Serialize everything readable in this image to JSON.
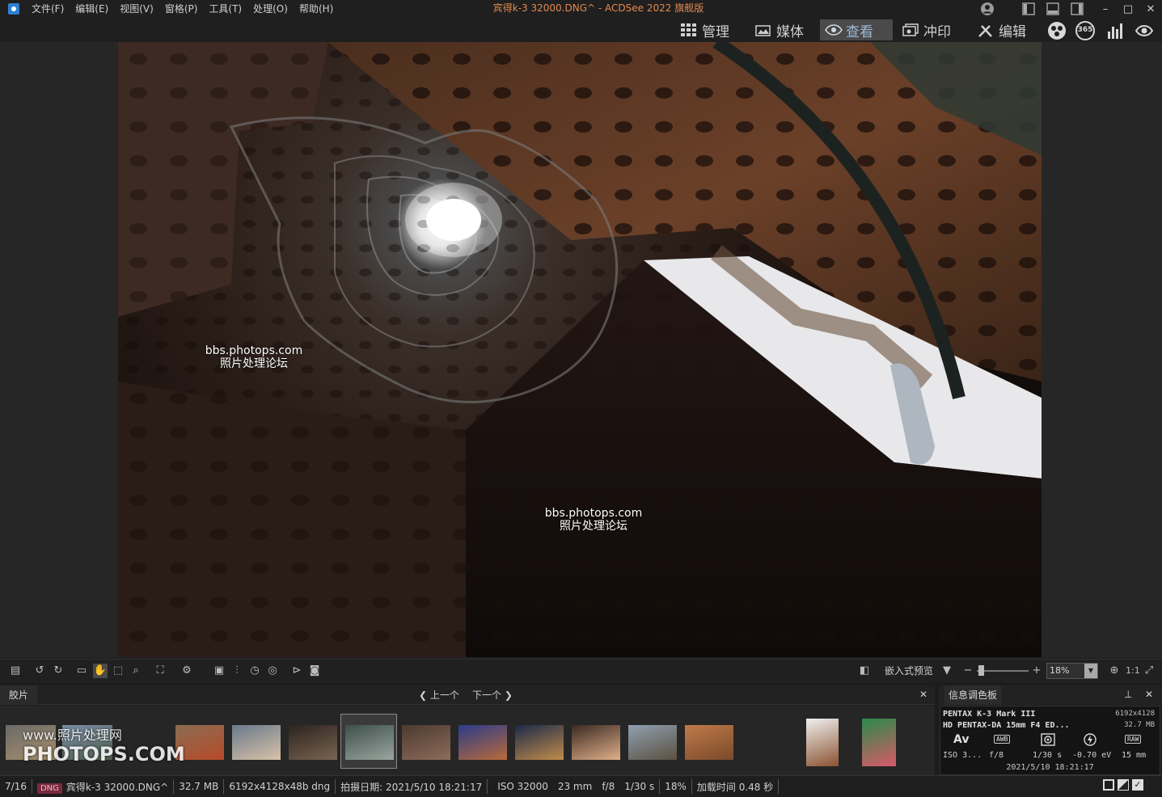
{
  "menu": [
    "文件(F)",
    "编辑(E)",
    "视图(V)",
    "窗格(P)",
    "工具(T)",
    "处理(O)",
    "帮助(H)"
  ],
  "window_title": "宾得k-3 32000.DNG^ - ACDSee 2022 旗舰版",
  "window_controls": [
    "–",
    "□",
    "✕"
  ],
  "modes": [
    {
      "label": "管理",
      "icon": "grid-icon"
    },
    {
      "label": "媒体",
      "icon": "media-icon"
    },
    {
      "label": "查看",
      "icon": "eye-icon",
      "active": true
    },
    {
      "label": "冲印",
      "icon": "develop-icon"
    },
    {
      "label": "编辑",
      "icon": "edit-icon"
    }
  ],
  "right_tools": {
    "badge_365": "365"
  },
  "watermarks": [
    {
      "line1": "bbs.photops.com",
      "line2": "照片处理论坛"
    },
    {
      "line1": "bbs.photops.com",
      "line2": "照片处理论坛"
    }
  ],
  "viewer_toolbar": {
    "embedded_preview": "嵌入式预览",
    "zoom_value": "18%",
    "one_to_one": "1:1"
  },
  "filmstrip": {
    "tab": "胶片",
    "prev": "上一个",
    "next": "下一个",
    "close": "✕",
    "watermark_line1": "www.照片处理网",
    "watermark_line2": "PHOTOPS.COM",
    "thumb_colors": [
      [
        "#6b6a68",
        "#a58e6b"
      ],
      [
        "#7b8ea8",
        "#4f5e4a"
      ],
      [
        "#8a6d52",
        "#b84a2a"
      ],
      [
        "#6a7a8c",
        "#d8c2a8"
      ],
      [
        "#2b2320",
        "#7a6450"
      ],
      [
        "#3e4f4a",
        "#9aa6a0"
      ],
      [
        "#4b3a30",
        "#8e6c5a"
      ],
      [
        "#2a3c8a",
        "#b96a3a"
      ],
      [
        "#1b2a4a",
        "#c28c4a"
      ],
      [
        "#3a2a22",
        "#e2b08a"
      ],
      [
        "#8fa0b0",
        "#5a5040"
      ],
      [
        "#c07a4a",
        "#7a4a2a"
      ],
      [
        "#f0f0f0",
        "#8a5230"
      ],
      [
        "#2a8a4a",
        "#d85a6a"
      ]
    ]
  },
  "info_palette": {
    "title": "信息调色板",
    "camera": "PENTAX K-3 Mark III",
    "lens": "HD PENTAX-DA 15mm F4 ED...",
    "resolution": "6192x4128",
    "size": "32.7 MB",
    "mode": "Av",
    "wb": "AWB",
    "raw": "RAW",
    "iso": "ISO 3...",
    "aperture": "f/8",
    "shutter": "1/30 s",
    "ev": "-0.70 eV",
    "focal": "15 mm",
    "date": "2021/5/10 18:21:17"
  },
  "status": {
    "index": "7/16",
    "format_badge": "DNG",
    "filename": "宾得k-3 32000.DNG^",
    "filesize": "32.7 MB",
    "dimensions": "6192x4128x48b dng",
    "date": "拍摄日期: 2021/5/10 18:21:17",
    "iso": "ISO 32000",
    "focal": "23 mm",
    "aperture": "f/8",
    "shutter": "1/30 s",
    "zoom": "18%",
    "load_time": "加载时间 0.48 秒"
  }
}
